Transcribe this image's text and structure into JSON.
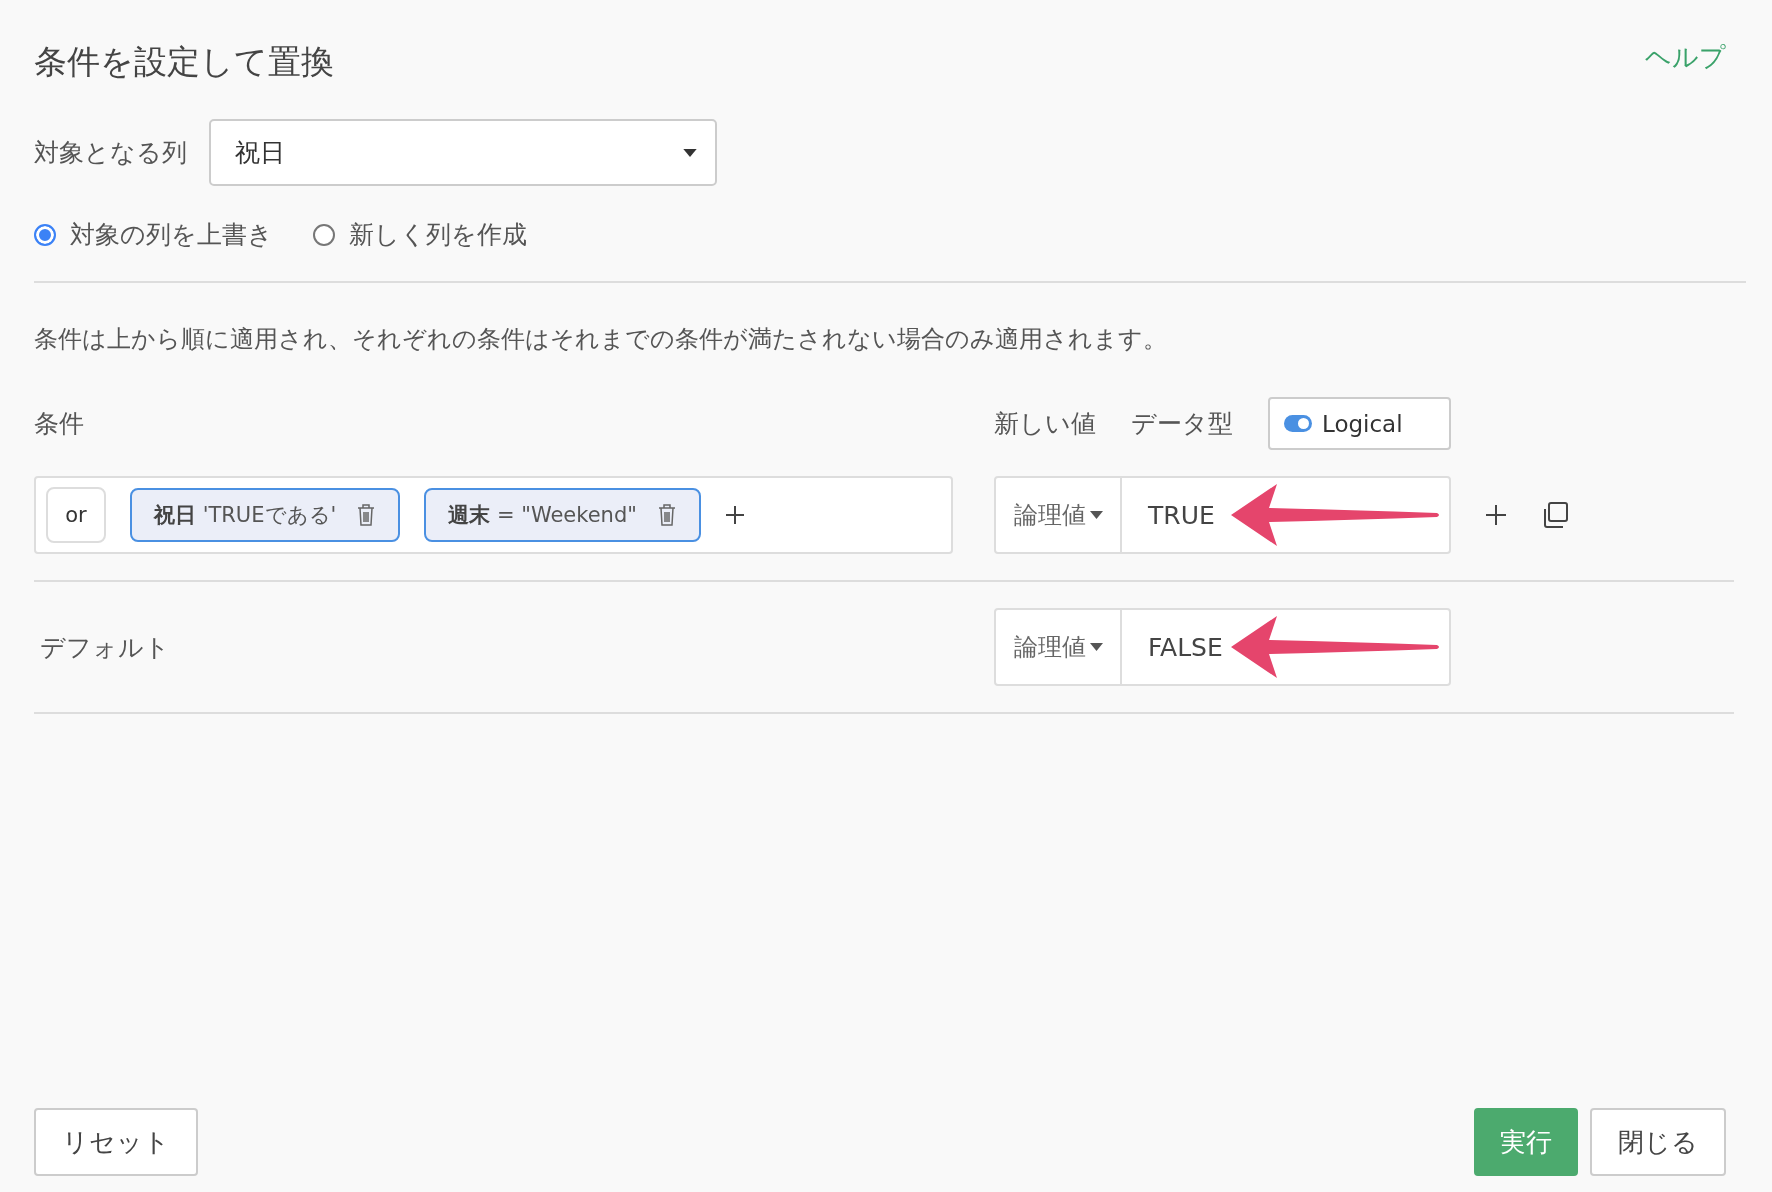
{
  "title": "条件を設定して置換",
  "help_link": "ヘルプ",
  "target_column": {
    "label": "対象となる列",
    "value": "祝日"
  },
  "output_mode": [
    {
      "label": "対象の列を上書き",
      "selected": true
    },
    {
      "label": "新しく列を作成",
      "selected": false
    }
  ],
  "description": "条件は上から順に適用され、それぞれの条件はそれまでの条件が満たされない場合のみ適用されます。",
  "headers": {
    "condition": "条件",
    "new_value": "新しい値",
    "data_type": "データ型"
  },
  "data_type_toggle": {
    "label": "Logical",
    "on": true
  },
  "conditions": [
    {
      "operator": "or",
      "chips": [
        "**祝日** 'TRUEである'",
        "**週末** = \"Weekend\""
      ],
      "value_type": "論理値",
      "value": "TRUE",
      "annotated": true
    }
  ],
  "default": {
    "label": "デフォルト",
    "value_type": "論理値",
    "value": "FALSE",
    "annotated": true
  },
  "buttons": {
    "reset": "リセット",
    "run": "実行",
    "close": "閉じる"
  }
}
